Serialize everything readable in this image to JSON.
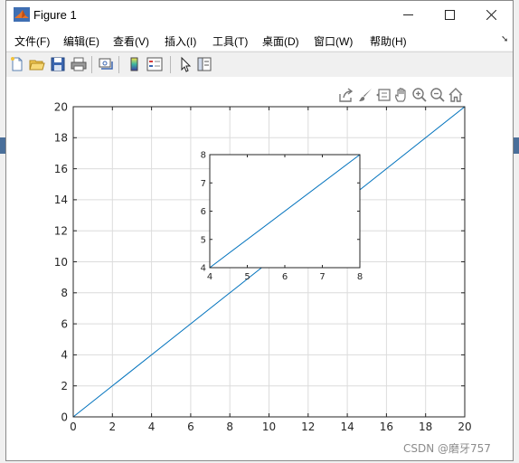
{
  "window": {
    "title": "Figure 1"
  },
  "menu": [
    {
      "label": "文件(F)"
    },
    {
      "label": "编辑(E)"
    },
    {
      "label": "查看(V)"
    },
    {
      "label": "插入(I)"
    },
    {
      "label": "工具(T)"
    },
    {
      "label": "桌面(D)"
    },
    {
      "label": "窗口(W)"
    },
    {
      "label": "帮助(H)"
    }
  ],
  "toolbar": [
    "new-figure-icon",
    "open-file-icon",
    "save-icon",
    "print-icon",
    "link-plot-icon",
    "colorbar-icon",
    "legend-icon",
    "pointer-icon",
    "property-editor-icon"
  ],
  "axes_toolbar": [
    "export-icon",
    "brush-icon",
    "datatip-icon",
    "pan-icon",
    "zoom-in-icon",
    "zoom-out-icon",
    "home-icon"
  ],
  "colors": {
    "line": "#0072bd",
    "grid": "#dcdcdc",
    "axis": "#262626"
  },
  "chart_data": [
    {
      "type": "line",
      "xlim": [
        0,
        20
      ],
      "ylim": [
        0,
        20
      ],
      "xticks": [
        0,
        2,
        4,
        6,
        8,
        10,
        12,
        14,
        16,
        18,
        20
      ],
      "yticks": [
        0,
        2,
        4,
        6,
        8,
        10,
        12,
        14,
        16,
        18,
        20
      ],
      "grid": true,
      "series": [
        {
          "x": [
            0,
            20
          ],
          "y": [
            0,
            20
          ]
        }
      ]
    },
    {
      "type": "line",
      "xlim": [
        4,
        8
      ],
      "ylim": [
        4,
        8
      ],
      "xticks": [
        4,
        5,
        6,
        7,
        8
      ],
      "yticks": [
        4,
        5,
        6,
        7,
        8
      ],
      "grid": false,
      "series": [
        {
          "x": [
            4,
            8
          ],
          "y": [
            4,
            8
          ]
        }
      ]
    }
  ],
  "watermark": "CSDN @磨牙757"
}
